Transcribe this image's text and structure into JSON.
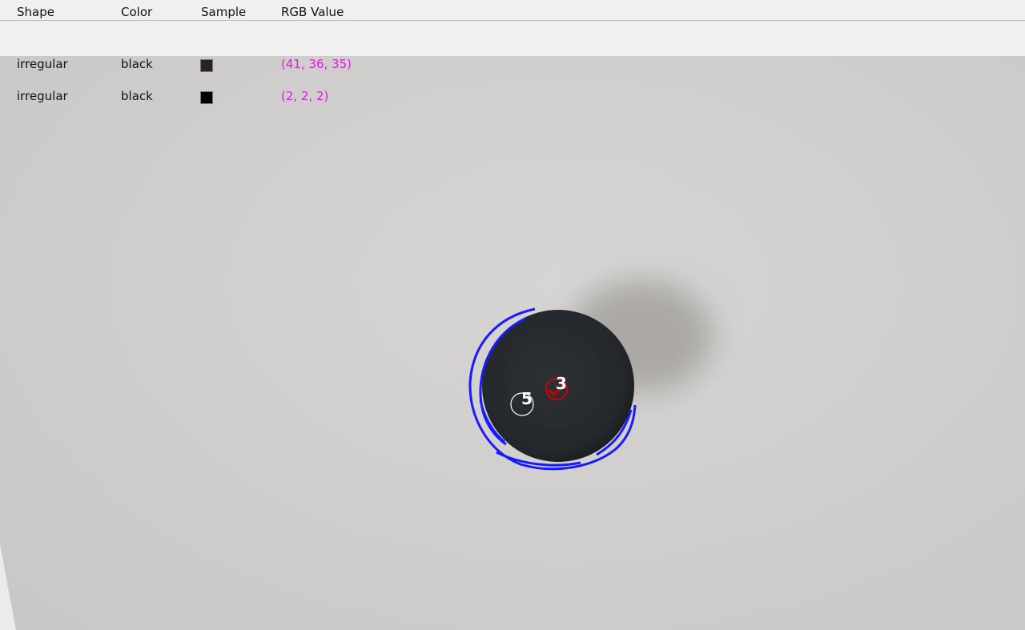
{
  "table": {
    "headers": {
      "shape": "Shape",
      "color": "Color",
      "sample": "Sample",
      "rgb": "RGB Value"
    },
    "rows": [
      {
        "shape": "irregular",
        "color": "black",
        "rgb_text": "(41, 36, 35)",
        "swatch_color": "#292423"
      },
      {
        "shape": "irregular",
        "color": "black",
        "rgb_text": "(2, 2, 2)",
        "swatch_color": "#020202"
      }
    ]
  },
  "overlay": {
    "labels": [
      "5",
      "3"
    ],
    "colors": {
      "contour": "#1a1aff",
      "marker_red": "#d00000",
      "marker_white": "#ffffff",
      "rgb_text": "#e21be2"
    }
  }
}
